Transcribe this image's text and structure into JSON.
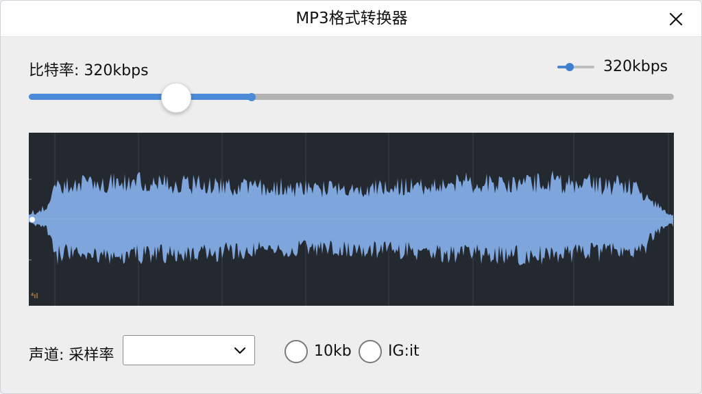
{
  "window": {
    "title": "MP3格式转换器"
  },
  "bitrate": {
    "label": "比特率: 320kbps",
    "value_text": "320kbps",
    "mini_slider_fraction": 0.33,
    "main_slider_thumb_fraction": 0.229,
    "main_slider_marker_fraction": 0.345
  },
  "waveform": {
    "marker_text": "⁴ıl",
    "colors": {
      "background": "#24282f",
      "wave": "#7ea6dc",
      "grid": "#3b4049",
      "marker": "#e8a24a"
    }
  },
  "channel": {
    "label": "声道: 采样率",
    "dropdown_value": ""
  },
  "options": [
    {
      "label": "10kb",
      "selected": false
    },
    {
      "label": "IG:it",
      "selected": false
    }
  ],
  "colors": {
    "accent": "#4a8ad6",
    "track": "#b3b3b3"
  },
  "icons": {
    "close": "close-icon",
    "dropdown": "chevron-down-icon"
  }
}
